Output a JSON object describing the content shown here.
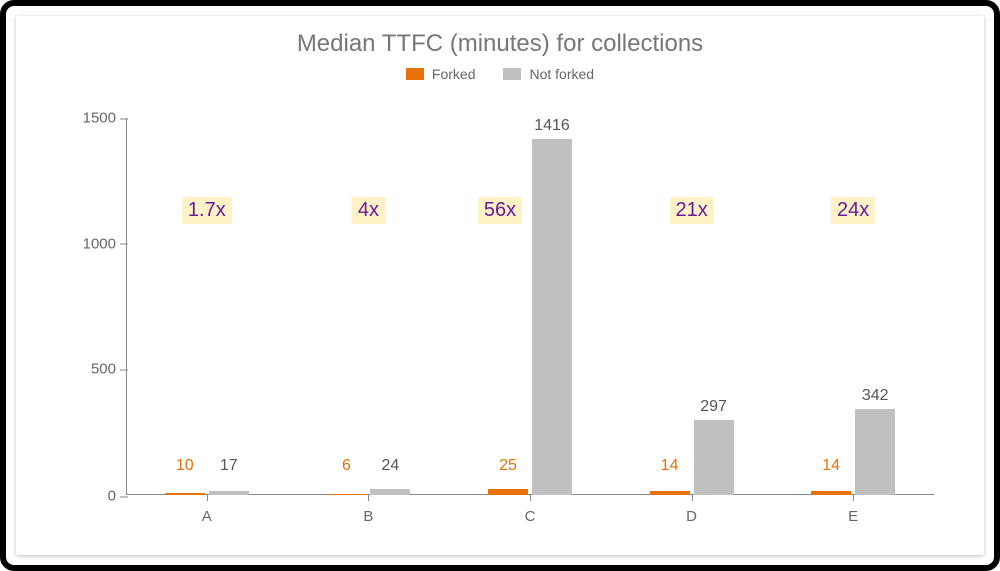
{
  "title": "Median TTFC (minutes) for collections",
  "legend": {
    "forked": "Forked",
    "notforked": "Not forked"
  },
  "colors": {
    "forked": "#e8710a",
    "notforked": "#c0c0c0",
    "annotation_bg": "#fff2c6",
    "annotation_text": "#6a1b9a"
  },
  "yticks": {
    "t0": "0",
    "t1": "500",
    "t2": "1000",
    "t3": "1500"
  },
  "categories": {
    "A": "A",
    "B": "B",
    "C": "C",
    "D": "D",
    "E": "E"
  },
  "values": {
    "A": {
      "forked": "10",
      "notforked": "17"
    },
    "B": {
      "forked": "6",
      "notforked": "24"
    },
    "C": {
      "forked": "25",
      "notforked": "1416"
    },
    "D": {
      "forked": "14",
      "notforked": "297"
    },
    "E": {
      "forked": "14",
      "notforked": "342"
    }
  },
  "annotations": {
    "A": "1.7x",
    "B": "4x",
    "C": "56x",
    "D": "21x",
    "E": "24x"
  },
  "chart_data": {
    "type": "bar",
    "title": "Median TTFC (minutes) for collections",
    "xlabel": "",
    "ylabel": "",
    "ylim": [
      0,
      1500
    ],
    "yticks": [
      0,
      500,
      1000,
      1500
    ],
    "categories": [
      "A",
      "B",
      "C",
      "D",
      "E"
    ],
    "series": [
      {
        "name": "Forked",
        "values": [
          10,
          6,
          25,
          14,
          14
        ]
      },
      {
        "name": "Not forked",
        "values": [
          17,
          24,
          1416,
          297,
          342
        ]
      }
    ],
    "annotations": [
      {
        "category": "A",
        "text": "1.7x"
      },
      {
        "category": "B",
        "text": "4x"
      },
      {
        "category": "C",
        "text": "56x"
      },
      {
        "category": "D",
        "text": "21x"
      },
      {
        "category": "E",
        "text": "24x"
      }
    ],
    "legend_position": "top",
    "grid": false
  }
}
